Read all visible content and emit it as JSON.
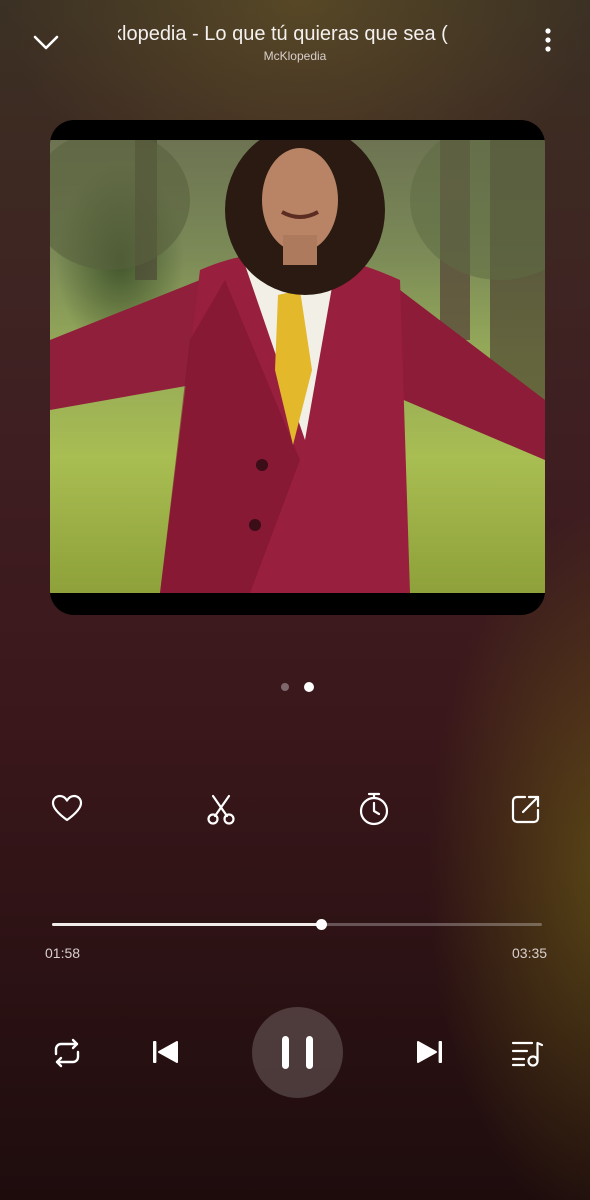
{
  "header": {
    "title": "klopedia - Lo que tú quieras que sea (",
    "artist": "McKlopedia"
  },
  "icons": {
    "collapse": "chevron-down-icon",
    "more": "more-vertical-icon",
    "favorite": "heart-icon",
    "cut": "scissors-icon",
    "timer": "timer-icon",
    "share": "share-icon",
    "repeat": "repeat-icon",
    "previous": "skip-previous-icon",
    "pause": "pause-icon",
    "next": "skip-next-icon",
    "queue": "queue-music-icon"
  },
  "pager": {
    "count": 2,
    "active": 2
  },
  "progress": {
    "elapsed": "01:58",
    "duration": "03:35",
    "fraction": 0.549
  },
  "colors": {
    "accent": "#ffffff",
    "track": "#f1ecea"
  }
}
